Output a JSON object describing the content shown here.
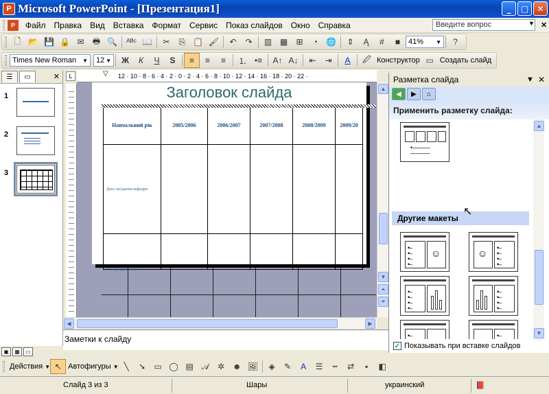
{
  "window": {
    "title": "Microsoft PowerPoint - [Презентация1]",
    "app_icon": "P"
  },
  "menu": {
    "items": [
      "Файл",
      "Правка",
      "Вид",
      "Вставка",
      "Формат",
      "Сервис",
      "Показ слайдов",
      "Окно",
      "Справка"
    ],
    "help_placeholder": "Введите вопрос"
  },
  "standard_toolbar": {
    "zoom": "41%"
  },
  "format_toolbar": {
    "font": "Times New Roman",
    "size": "12",
    "bold": "Ж",
    "italic": "К",
    "underline": "Ч",
    "shadow": "S",
    "designer_label": "Конструктор",
    "new_slide_label": "Создать слайд"
  },
  "thumbnails": [
    {
      "num": "1"
    },
    {
      "num": "2"
    },
    {
      "num": "3"
    }
  ],
  "ruler": {
    "h_labels": "12 · 10 · 8 · 6 · 4 · 2 · 0 · 2 · 4 · 6 · 8 · 10 · 12 · 14 · 16 · 18 · 20 · 22 ·"
  },
  "slide": {
    "title": "Заголовок слайда",
    "table": {
      "headers": [
        "Навчальний рік",
        "2005/2006",
        "2006/2007",
        "2007/2008",
        "2008/2009",
        "2009/20"
      ],
      "row_label": "Дата засідання кафедри",
      "footer_label": "Номер протоколу"
    }
  },
  "notes": {
    "text": "Заметки к слайду"
  },
  "taskpane": {
    "title": "Разметка слайда",
    "apply_label": "Применить разметку слайда:",
    "other_layouts": "Другие макеты",
    "checkbox_label": "Показывать при вставке слайдов",
    "checkbox_checked": true
  },
  "drawing_toolbar": {
    "actions_label": "Действия",
    "autoshapes_label": "Автофигуры"
  },
  "status": {
    "slide": "Слайд 3 из 3",
    "design": "Шары",
    "language": "украинский"
  }
}
